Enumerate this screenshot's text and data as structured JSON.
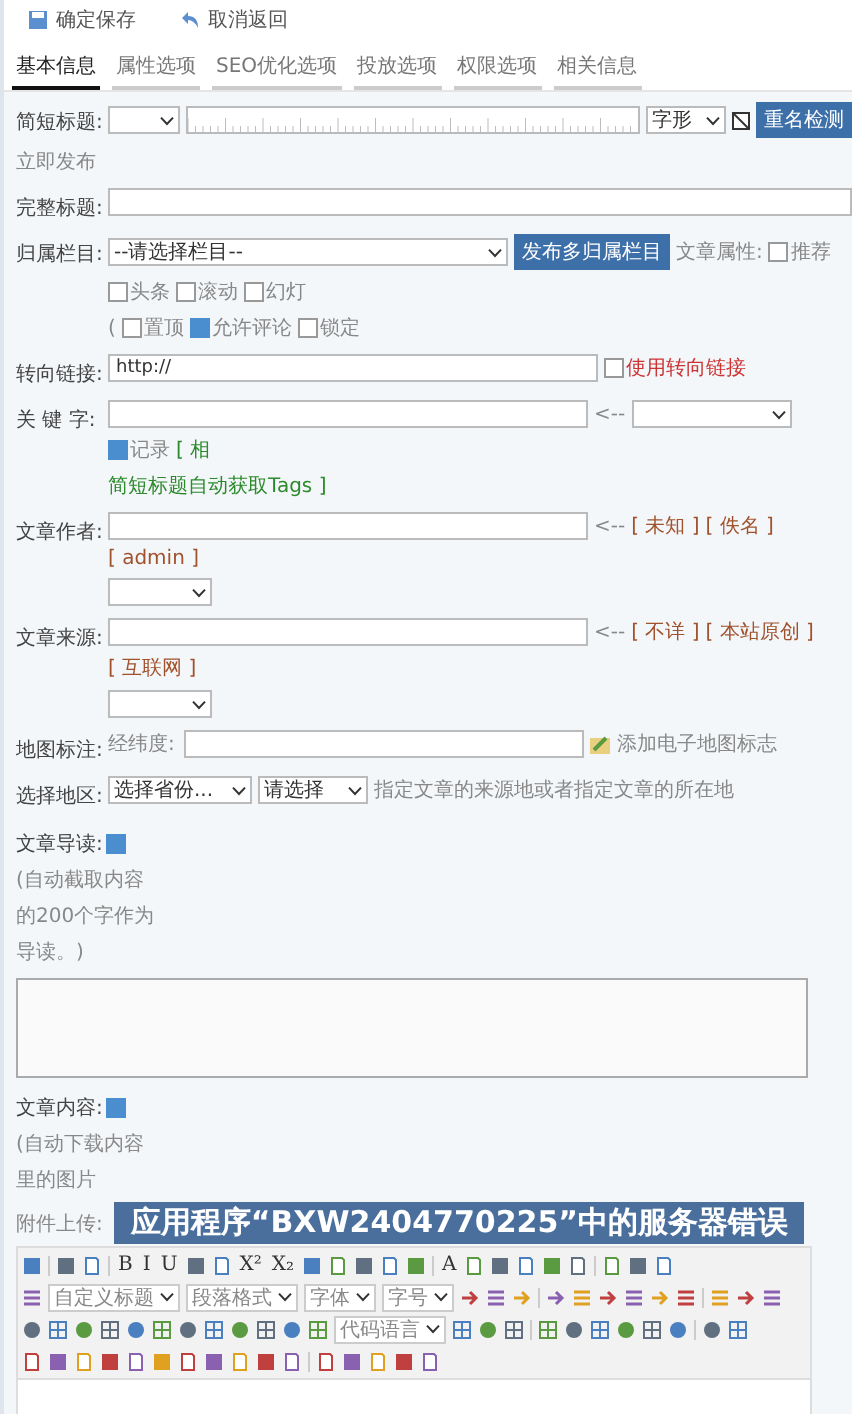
{
  "toolbar": [
    {
      "kind": "save",
      "label": "确定保存"
    },
    {
      "kind": "back",
      "label": "取消返回"
    }
  ],
  "tabs": [
    {
      "label": "基本信息",
      "selected": true
    },
    {
      "label": "属性选项",
      "selected": false
    },
    {
      "label": "SEO优化选项",
      "selected": false
    },
    {
      "label": "投放选项",
      "selected": false
    },
    {
      "label": "权限选项",
      "selected": false
    },
    {
      "label": "相关信息",
      "selected": false
    }
  ],
  "short_title": {
    "label": "简短标题:",
    "note": "立即发布",
    "font_select": "字形",
    "check_button": "重名检测"
  },
  "full_title": {
    "label": "完整标题:"
  },
  "category": {
    "label": "归属栏目:",
    "select": "--请选择栏目--",
    "multi_button": "发布多归属栏目",
    "attr_label": "文章属性:",
    "attrs": [
      {
        "label": "推荐",
        "checked": false
      },
      {
        "label": "头条",
        "checked": false
      },
      {
        "label": "滚动",
        "checked": false
      },
      {
        "label": "幻灯",
        "checked": false
      }
    ],
    "open": "(",
    "options": [
      {
        "label": "置顶",
        "checked": false
      },
      {
        "label": "允许评论",
        "checked": true
      },
      {
        "label": "锁定",
        "checked": false
      }
    ]
  },
  "redirect": {
    "label": "转向链接:",
    "value": "http://",
    "option": {
      "label": "使用转向链接",
      "checked": false
    }
  },
  "keywords": {
    "label": "关 键 字:",
    "arrow": "<--",
    "record": {
      "label": "记录",
      "checked": true
    },
    "more": "[ 相",
    "auto": "简短标题自动获取Tags ]"
  },
  "author": {
    "label": "文章作者:",
    "arrow": "<--",
    "picks": [
      "[ 未知 ]",
      "[ 佚名 ]",
      "[ admin ]"
    ]
  },
  "source": {
    "label": "文章来源:",
    "arrow": "<--",
    "picks": [
      "[ 不详 ]",
      "[ 本站原创 ]",
      "[ 互联网 ]"
    ]
  },
  "map": {
    "label": "地图标注:",
    "coord_label": "经纬度:",
    "link": "添加电子地图标志"
  },
  "region": {
    "label": "选择地区:",
    "province": "选择省份...",
    "city": "请选择",
    "hint": "指定文章的来源地或者指定文章的所在地"
  },
  "summary": {
    "label": "文章导读:",
    "checked": true,
    "hint": [
      "(自动截取内容",
      "的200个字作为",
      "导读。)"
    ]
  },
  "content": {
    "label": "文章内容:",
    "checked": true,
    "hint": [
      "(自动下载内容",
      "里的图片"
    ]
  },
  "attachment": {
    "label": "附件上传:"
  },
  "error_banner": "应用程序“BXW2404770225”中的服务器错误",
  "editor": {
    "rows": [
      [
        {
          "kind": "icon"
        },
        {
          "kind": "sep"
        },
        {
          "kind": "icon"
        },
        {
          "kind": "icon"
        },
        {
          "kind": "sep"
        },
        {
          "kind": "glyph",
          "text": "B"
        },
        {
          "kind": "glyph",
          "text": "I"
        },
        {
          "kind": "glyph",
          "text": "U"
        },
        {
          "kind": "icon"
        },
        {
          "kind": "icon"
        },
        {
          "kind": "glyph",
          "text": "X²"
        },
        {
          "kind": "glyph",
          "text": "X₂"
        },
        {
          "kind": "icon"
        },
        {
          "kind": "icon"
        },
        {
          "kind": "icon"
        },
        {
          "kind": "icon"
        },
        {
          "kind": "icon"
        },
        {
          "kind": "sep"
        },
        {
          "kind": "glyph",
          "text": "A"
        },
        {
          "kind": "icon"
        },
        {
          "kind": "icon"
        },
        {
          "kind": "icon"
        },
        {
          "kind": "icon"
        },
        {
          "kind": "icon"
        },
        {
          "kind": "sep"
        },
        {
          "kind": "icon"
        },
        {
          "kind": "icon"
        },
        {
          "kind": "icon"
        }
      ],
      [
        {
          "kind": "icon"
        },
        {
          "kind": "select",
          "text": "自定义标题"
        },
        {
          "kind": "select",
          "text": "段落格式"
        },
        {
          "kind": "select",
          "text": "字体"
        },
        {
          "kind": "select",
          "text": "字号"
        },
        {
          "kind": "icon"
        },
        {
          "kind": "icon"
        },
        {
          "kind": "icon"
        },
        {
          "kind": "sep"
        },
        {
          "kind": "icon"
        },
        {
          "kind": "icon"
        },
        {
          "kind": "icon"
        },
        {
          "kind": "icon"
        },
        {
          "kind": "icon"
        },
        {
          "kind": "icon"
        },
        {
          "kind": "sep"
        },
        {
          "kind": "icon"
        },
        {
          "kind": "icon"
        },
        {
          "kind": "icon"
        }
      ],
      [
        {
          "kind": "icon"
        },
        {
          "kind": "icon"
        },
        {
          "kind": "icon"
        },
        {
          "kind": "icon"
        },
        {
          "kind": "icon"
        },
        {
          "kind": "icon"
        },
        {
          "kind": "icon"
        },
        {
          "kind": "icon"
        },
        {
          "kind": "icon"
        },
        {
          "kind": "icon"
        },
        {
          "kind": "icon"
        },
        {
          "kind": "icon"
        },
        {
          "kind": "select",
          "text": "代码语言"
        },
        {
          "kind": "icon"
        },
        {
          "kind": "icon"
        },
        {
          "kind": "icon"
        },
        {
          "kind": "sep"
        },
        {
          "kind": "icon"
        },
        {
          "kind": "icon"
        },
        {
          "kind": "icon"
        },
        {
          "kind": "icon"
        },
        {
          "kind": "icon"
        },
        {
          "kind": "icon"
        },
        {
          "kind": "sep"
        },
        {
          "kind": "icon"
        },
        {
          "kind": "icon"
        }
      ],
      [
        {
          "kind": "icon"
        },
        {
          "kind": "icon"
        },
        {
          "kind": "icon"
        },
        {
          "kind": "icon"
        },
        {
          "kind": "icon"
        },
        {
          "kind": "icon"
        },
        {
          "kind": "icon"
        },
        {
          "kind": "icon"
        },
        {
          "kind": "icon"
        },
        {
          "kind": "icon"
        },
        {
          "kind": "icon"
        },
        {
          "kind": "sep"
        },
        {
          "kind": "icon"
        },
        {
          "kind": "icon"
        },
        {
          "kind": "icon"
        },
        {
          "kind": "icon"
        },
        {
          "kind": "icon"
        }
      ]
    ]
  }
}
